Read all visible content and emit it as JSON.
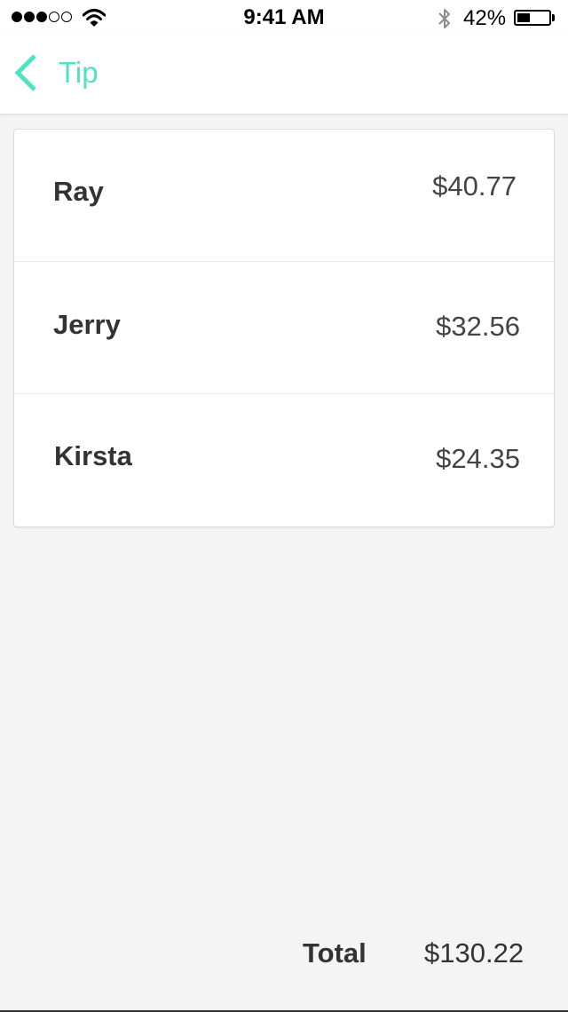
{
  "status_bar": {
    "signal_strength": 3,
    "signal_max": 5,
    "time": "9:41 AM",
    "battery_percent": "42%",
    "battery_level": 0.42,
    "icons": [
      "signal-dots",
      "wifi-icon",
      "bluetooth-icon",
      "battery-icon"
    ]
  },
  "nav": {
    "back_label": "Tip",
    "back_icon": "chevron-left-icon",
    "accent_color": "#50e3c2"
  },
  "people": [
    {
      "name": "Ray",
      "amount": "$40.77"
    },
    {
      "name": "Jerry",
      "amount": "$32.56"
    },
    {
      "name": "Kirsta",
      "amount": "$24.35"
    }
  ],
  "footer": {
    "total_label": "Total",
    "total_value": "$130.22"
  }
}
